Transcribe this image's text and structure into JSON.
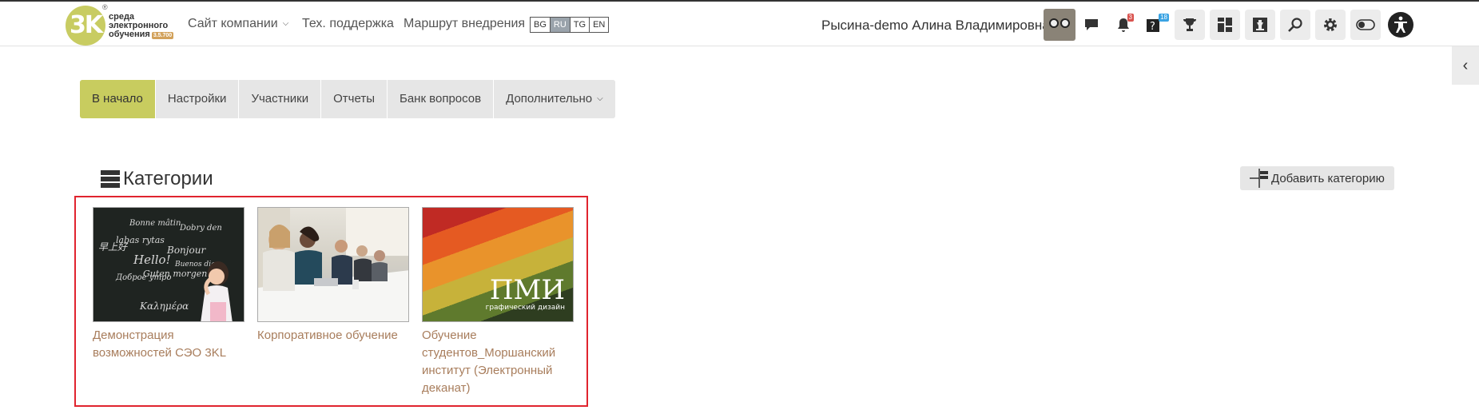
{
  "header": {
    "logo": {
      "mark": "3K",
      "reg": "®",
      "line1": "среда",
      "line2": "электронного",
      "line3": "обучения",
      "version": "3.5.700"
    },
    "nav": [
      {
        "label": "Сайт компании",
        "dropdown": true
      },
      {
        "label": "Тех. поддержка",
        "dropdown": false
      },
      {
        "label": "Маршрут внедрения",
        "dropdown": false
      }
    ],
    "languages": [
      {
        "code": "BG",
        "active": false
      },
      {
        "code": "RU",
        "active": true
      },
      {
        "code": "TG",
        "active": false
      },
      {
        "code": "EN",
        "active": false
      }
    ],
    "user_name": "Рысина-demo Алина Владимировна",
    "notifications_count": "3",
    "questions_count": "18",
    "icons": [
      "chat-icon",
      "bell-icon",
      "question-icon",
      "trophy-icon",
      "dashboard-icon",
      "chess-icon",
      "search-icon",
      "gear-icon",
      "toggle-icon",
      "accessibility-icon"
    ]
  },
  "tabs": [
    {
      "label": "В начало",
      "active": true
    },
    {
      "label": "Настройки",
      "active": false
    },
    {
      "label": "Участники",
      "active": false
    },
    {
      "label": "Отчеты",
      "active": false
    },
    {
      "label": "Банк вопросов",
      "active": false
    },
    {
      "label": "Дополнительно",
      "active": false,
      "dropdown": true
    }
  ],
  "categories": {
    "title": "Категории",
    "add_button_label": "Добавить категорию",
    "items": [
      {
        "title": "Демонстрация возможностей СЭО 3KL",
        "image": "chalkboard",
        "chalk_words": [
          "Bonne mâtin",
          "Dobry den",
          "labas rytas",
          "Bonjour",
          "Hello!",
          "Guten morgen",
          "Buenos dias",
          "Доброе утро",
          "Καλημέρα",
          "早上好"
        ]
      },
      {
        "title": "Корпоративное обучение",
        "image": "meeting"
      },
      {
        "title": "Обучение студентов_Моршанский институт (Электронный деканат)",
        "image": "painted-wall",
        "image_text": "ПМИ",
        "image_subtext": "графический дизайн"
      }
    ]
  },
  "colors": {
    "accent": "#c8cc5f",
    "link": "#a87d5c",
    "highlight": "#e0242e"
  }
}
